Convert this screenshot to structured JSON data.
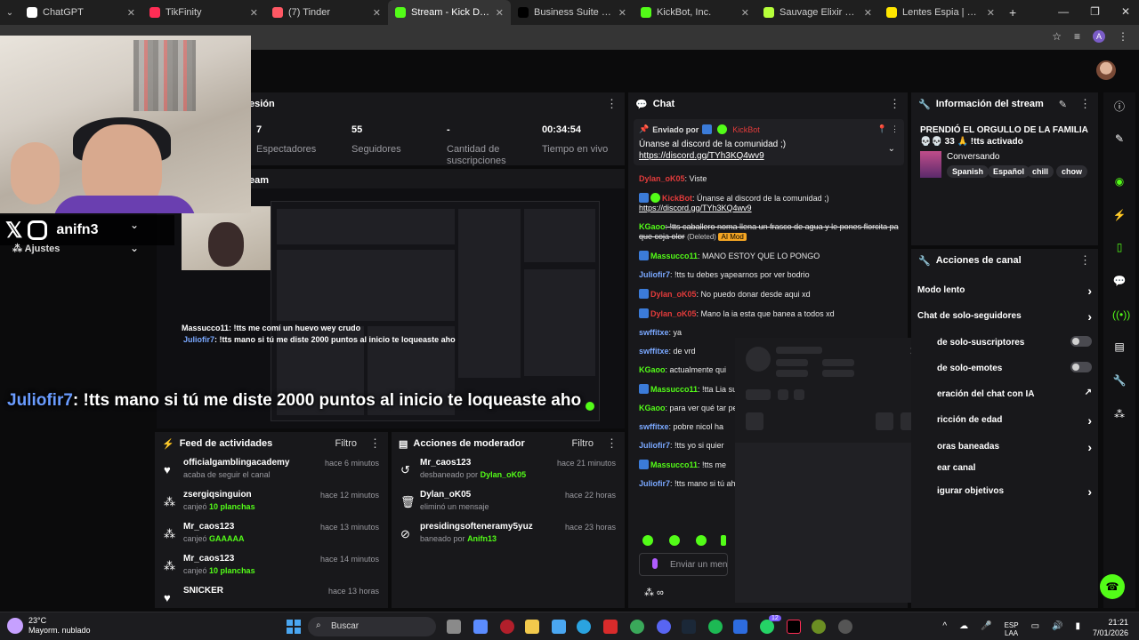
{
  "browser": {
    "tabs": [
      {
        "title": "ChatGPT",
        "color": "#ffffff"
      },
      {
        "title": "TikFinity",
        "color": "#ff2d55"
      },
      {
        "title": "(7) Tinder",
        "color": "#ff5864"
      },
      {
        "title": "Stream - Kick Dashboard",
        "color": "#53fc18",
        "active": true
      },
      {
        "title": "Business Suite | TikTok",
        "color": "#000000"
      },
      {
        "title": "KickBot, Inc.",
        "color": "#53fc18"
      },
      {
        "title": "Sauvage Elixir Parfum Di",
        "color": "#b6ff3a"
      },
      {
        "title": "Lentes Espia | Mercado Li",
        "color": "#ffe600"
      }
    ],
    "profile_initial": "A"
  },
  "session": {
    "title": "esión",
    "stats": [
      {
        "value": "7",
        "label": "Espectadores"
      },
      {
        "value": "55",
        "label": "Seguidores"
      },
      {
        "value": "-",
        "label": "Cantidad de suscripciones"
      },
      {
        "value": "00:34:54",
        "label": "Tiempo en vivo"
      }
    ]
  },
  "overlay": {
    "handle": "anifn3",
    "ajustes": "Ajustes",
    "stream_label": "eam",
    "mini_line1_user": "Massucco11",
    "mini_line1_text": ": !tts me comí un huevo wey crudo",
    "mini_line2_user": "Juliofir7",
    "mini_line2_text": ": !tts mano si tú me diste 2000 puntos al inicio te loqueaste aho",
    "caption_user": "Juliofir7",
    "caption_text": ": !tts mano si tú me diste 2000 puntos al inicio te loqueaste aho"
  },
  "feed": {
    "title": "Feed de actividades",
    "filter": "Filtro",
    "items": [
      {
        "icon": "heart-icon",
        "glyph": "♥",
        "name": "officialgamblingacademy",
        "sub": "acaba de seguir el canal",
        "bold": "",
        "time": "hace 6 minutos"
      },
      {
        "icon": "kick-points-icon",
        "glyph": "⁂",
        "name": "zsergiqsinguion",
        "sub": "canjeó",
        "bold": "10 planchas",
        "time": "hace 12 minutos"
      },
      {
        "icon": "kick-points-icon",
        "glyph": "⁂",
        "name": "Mr_caos123",
        "sub": "canjeó",
        "bold": "GAAAAA",
        "time": "hace 13 minutos"
      },
      {
        "icon": "kick-points-icon",
        "glyph": "⁂",
        "name": "Mr_caos123",
        "sub": "canjeó",
        "bold": "10 planchas",
        "time": "hace 14 minutos"
      },
      {
        "icon": "heart-icon",
        "glyph": "♥",
        "name": "SNICKER",
        "sub": "",
        "bold": "",
        "time": "hace 13 horas"
      }
    ]
  },
  "mod": {
    "title": "Acciones de moderador",
    "filter": "Filtro",
    "items": [
      {
        "icon": "unban-icon",
        "glyph": "↺",
        "name": "Mr_caos123",
        "sub": "desbaneado por",
        "bold": "Dylan_oK05",
        "time": "hace 21 minutos"
      },
      {
        "icon": "trash-icon",
        "glyph": "🗑",
        "name": "Dylan_oK05",
        "sub": "eliminó un mensaje",
        "bold": "",
        "time": "hace 22 horas"
      },
      {
        "icon": "ban-icon",
        "glyph": "⊘",
        "name": "presidingsofteneramy5yuz",
        "sub": "baneado por",
        "bold": "Anifn13",
        "time": "hace 23 horas"
      }
    ]
  },
  "chat": {
    "title": "Chat",
    "pinned": {
      "by": "Enviado por",
      "user": "KickBot",
      "msg": "Únanse al discord de la comunidad ;)",
      "link": "https://discord.gg/TYh3KQ4wv9"
    },
    "messages": [
      {
        "user": "Dylan_oK05",
        "color": "#e23b3b",
        "text": ": Viste",
        "badge": ""
      },
      {
        "user": "KickBot",
        "color": "#e23b3b",
        "text": ": Únanse al discord de la comunidad ;)",
        "link": "https://discord.gg/TYh3KQ4wv9",
        "badge": "bot"
      },
      {
        "user": "KGaoo",
        "color": "#53fc18",
        "text": ": !tts caballero noma llena un frasco de agua y le pones florcita pa que coja olor",
        "deleted": "(Deleted)",
        "aimod": "AI Mod"
      },
      {
        "user": "Massucco11",
        "color": "#53fc18",
        "text": ": MANO ESTOY QUE LO PONGO",
        "badge": "sub"
      },
      {
        "user": "Juliofir7",
        "color": "#7aa8ff",
        "text": ": !tts tu debes yapearnos por ver bodrio",
        "badge": ""
      },
      {
        "user": "Dylan_oK05",
        "color": "#e23b3b",
        "text": ": No puedo donar desde aqui xd",
        "badge": "sub"
      },
      {
        "user": "Dylan_oK05",
        "color": "#e23b3b",
        "text": ": Mano la ia esta que banea a todos xd",
        "badge": "sub"
      },
      {
        "user": "swffitxe",
        "color": "#7aa8ff",
        "text": ": ya",
        "badge": ""
      },
      {
        "user": "swffitxe",
        "color": "#7aa8ff",
        "text": ": de vrd",
        "badge": ""
      },
      {
        "user": "KGaoo",
        "color": "#53fc18",
        "text": ": actualmente qui",
        "badge": ""
      },
      {
        "user": "Massucco11",
        "color": "#53fc18",
        "text": ": !tta Lia su ex",
        "badge": "sub"
      },
      {
        "user": "KGaoo",
        "color": "#53fc18",
        "text": ": para ver qué tar peladito",
        "badge": ""
      },
      {
        "user": "swffitxe",
        "color": "#7aa8ff",
        "text": ": pobre nicol ha",
        "badge": ""
      },
      {
        "user": "Juliofir7",
        "color": "#7aa8ff",
        "text": ": !tts yo si quier",
        "badge": ""
      },
      {
        "user": "Massucco11",
        "color": "#53fc18",
        "text": ": !tts me",
        "badge": "sub"
      },
      {
        "user": "Juliofir7",
        "color": "#7aa8ff",
        "text": ": !tts mano si tú aho",
        "badge": ""
      }
    ],
    "input_placeholder": "Enviar un men"
  },
  "stream_info": {
    "title": "Información del stream",
    "stream_title": "PRENDIÓ EL ORGULLO DE LA FAMILIA 💀💀 33 🙏 !tts activado",
    "category": "Conversando",
    "tags": [
      "Spanish",
      "Español",
      "chill",
      "chow"
    ]
  },
  "canal": {
    "title": "Acciones de canal",
    "rows": [
      {
        "label": "Modo lento",
        "control": "chevron"
      },
      {
        "label": "Chat de solo-seguidores",
        "control": "chevron"
      },
      {
        "label": "de solo-suscriptores",
        "control": "toggle"
      },
      {
        "label": "de solo-emotes",
        "control": "toggle"
      },
      {
        "label": "eración del chat con IA",
        "control": "external"
      },
      {
        "label": "ricción de edad",
        "control": "chevron"
      },
      {
        "label": "oras baneadas",
        "control": "chevron"
      },
      {
        "label": "ear canal",
        "control": "none"
      },
      {
        "label": "igurar objetivos",
        "control": "chevron"
      }
    ]
  },
  "taskbar": {
    "temp": "23°C",
    "weather": "Mayorm. nublado",
    "search": "Buscar",
    "lang1": "ESP",
    "lang2": "LAA",
    "time": "21:21",
    "date": "7/01/2026",
    "badge_count": "12"
  }
}
